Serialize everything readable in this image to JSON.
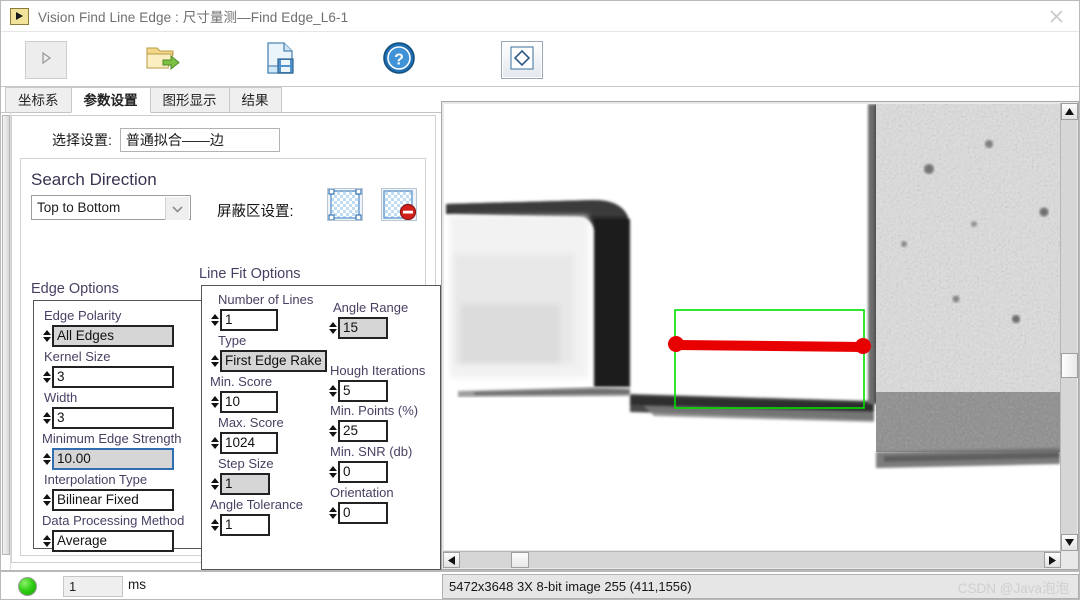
{
  "window": {
    "title": "Vision Find Line Edge : 尺寸量测—Find Edge_L6-1",
    "app_icon": "play-triangle-icon",
    "close_icon": "close-icon"
  },
  "toolbar": {
    "buttons": [
      {
        "name": "run-button",
        "icon": "play-triangle-icon",
        "state": "disabled"
      },
      {
        "name": "open-button",
        "icon": "open-folder-icon",
        "state": "normal"
      },
      {
        "name": "save-button",
        "icon": "save-file-icon",
        "state": "normal"
      },
      {
        "name": "help-button",
        "icon": "question-mark-icon",
        "state": "normal"
      },
      {
        "name": "shape-button",
        "icon": "diamond-icon",
        "state": "selected"
      }
    ]
  },
  "tabs": [
    {
      "label": "坐标系",
      "active": false
    },
    {
      "label": "参数设置",
      "active": true
    },
    {
      "label": "图形显示",
      "active": false
    },
    {
      "label": "结果",
      "active": false
    }
  ],
  "settings": {
    "select_setting_label": "选择设置:",
    "select_setting_value": "普通拟合——边",
    "search_direction": {
      "title": "Search Direction",
      "value": "Top to Bottom",
      "chevron": "chevron-down-icon"
    },
    "mask_area": {
      "label": "屏蔽区设置:",
      "add_icon": "mask-region-add-icon",
      "remove_icon": "mask-region-remove-icon"
    },
    "edge_options": {
      "title": "Edge Options",
      "fields": [
        {
          "label": "Edge Polarity",
          "value": "All Edges",
          "style": "grey"
        },
        {
          "label": "Kernel Size",
          "value": "3",
          "style": "white"
        },
        {
          "label": "Width",
          "value": "3",
          "style": "white"
        },
        {
          "label": "Minimum Edge Strength",
          "value": "10.00",
          "style": "selected"
        },
        {
          "label": "Interpolation Type",
          "value": "Bilinear Fixed",
          "style": "white"
        },
        {
          "label": "Data Processing Method",
          "value": "Average",
          "style": "white"
        }
      ]
    },
    "line_fit_options": {
      "title": "Line Fit Options",
      "left_fields": [
        {
          "label": "Number of Lines",
          "value": "1",
          "style": "white"
        },
        {
          "label": "Type",
          "value": "First Edge Rake",
          "style": "grey"
        },
        {
          "label": "Min. Score",
          "value": "10",
          "style": "white"
        },
        {
          "label": "Max. Score",
          "value": "1024",
          "style": "white"
        },
        {
          "label": "Step Size",
          "value": "1",
          "style": "grey"
        },
        {
          "label": "Angle Tolerance",
          "value": "1",
          "style": "white"
        }
      ],
      "right_fields": [
        {
          "label": "Angle Range",
          "value": "15",
          "style": "grey"
        },
        {
          "label": "Hough Iterations",
          "value": "5",
          "style": "white"
        },
        {
          "label": "Min. Points (%)",
          "value": "25",
          "style": "white"
        },
        {
          "label": "Min. SNR (db)",
          "value": "0",
          "style": "white"
        },
        {
          "label": "Orientation",
          "value": "0",
          "style": "white"
        }
      ]
    }
  },
  "viewer": {
    "roi_color": "#00e000",
    "fit_line_color": "#e80000",
    "vscroll_up_icon": "triangle-up-icon",
    "vscroll_down_icon": "triangle-down-icon",
    "hscroll_left_icon": "triangle-left-icon",
    "hscroll_right_icon": "triangle-right-icon"
  },
  "status": {
    "led": "status-led-green",
    "time_value": "1",
    "time_unit": "ms",
    "image_info": "5472x3648 3X 8-bit image 255    (411,1556)",
    "watermark": "CSDN @Java泡泡"
  }
}
